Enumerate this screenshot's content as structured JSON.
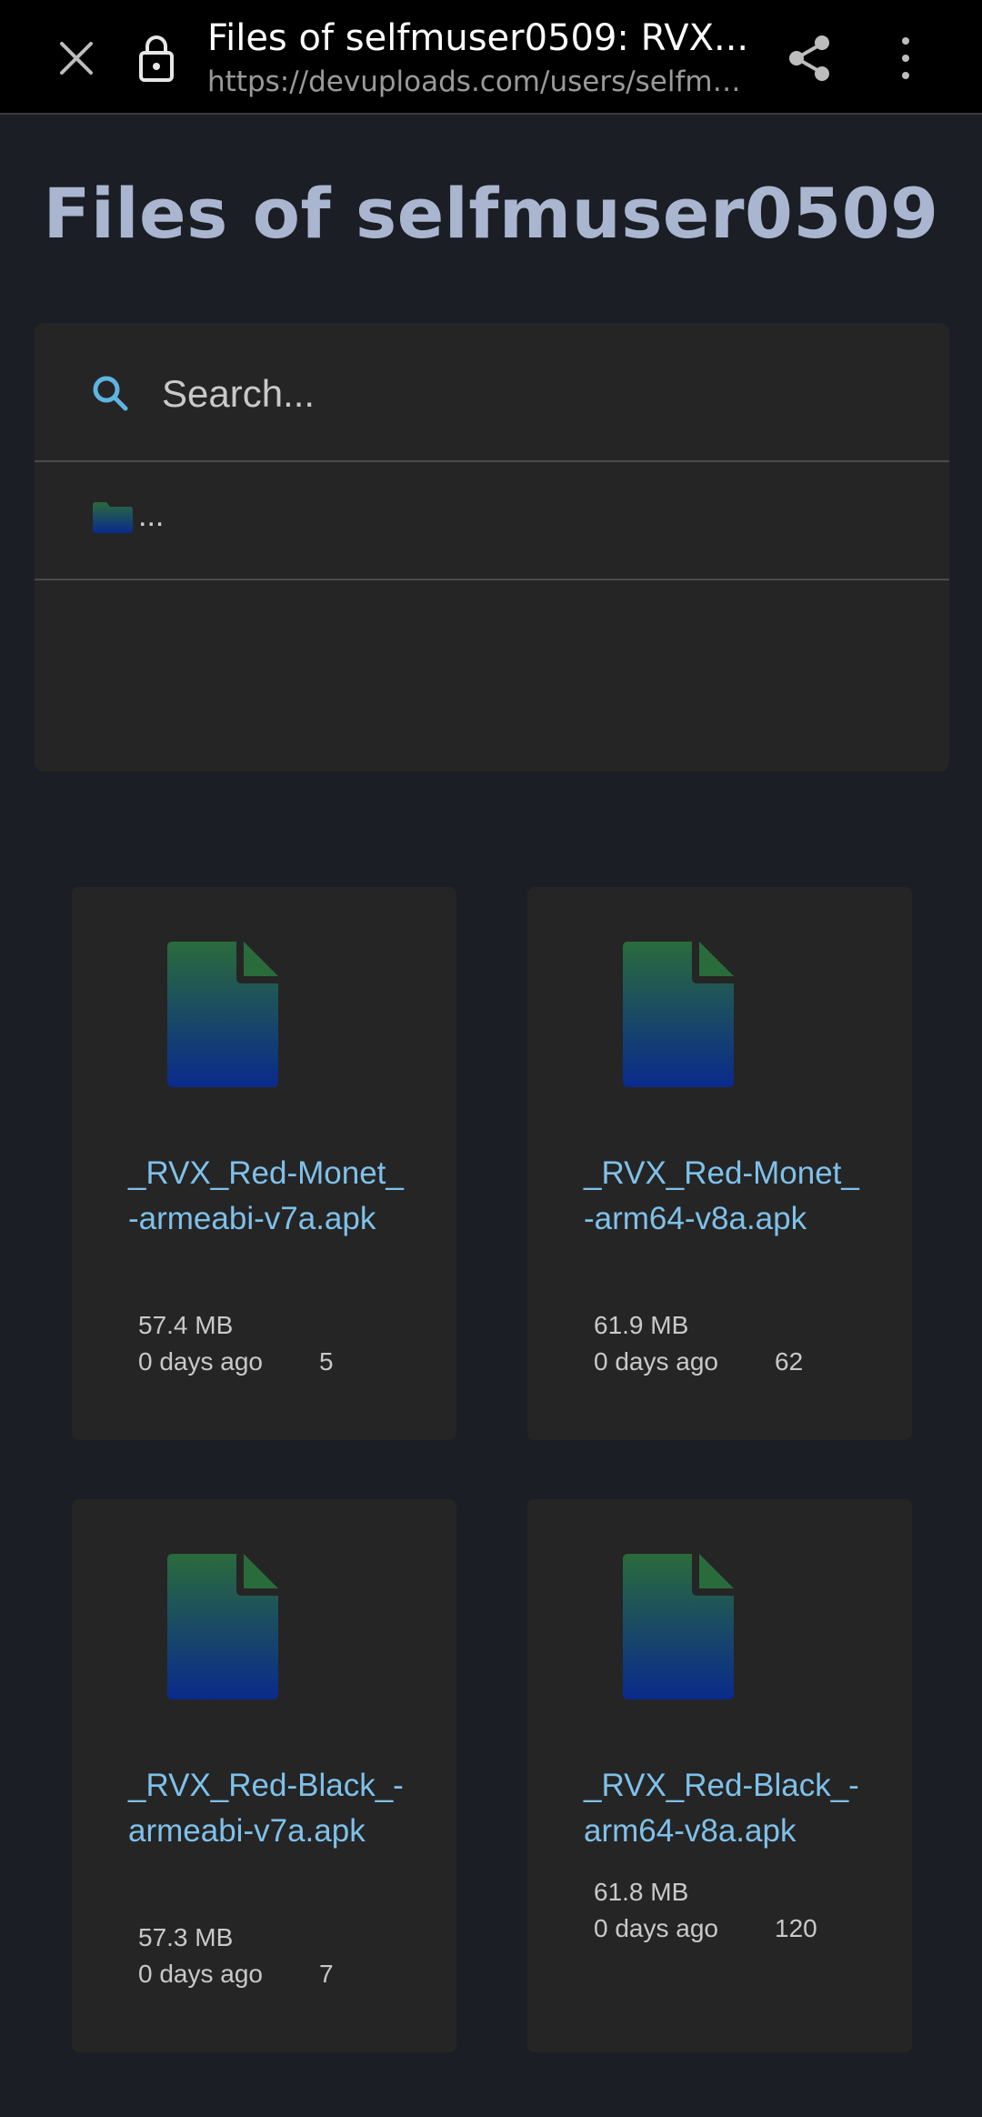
{
  "browser": {
    "page_title": "Files of selfmuser0509: RVX...",
    "url": "https://devuploads.com/users/selfmu..."
  },
  "page": {
    "heading": "Files of selfmuser0509",
    "search_placeholder": "Search...",
    "folder_label": "..."
  },
  "files": [
    {
      "name": "_RVX_Red-Monet_-armeabi-v7a.apk",
      "size": "57.4 MB",
      "age": "0 days ago",
      "count": "5"
    },
    {
      "name": "_RVX_Red-Monet_-arm64-v8a.apk",
      "size": "61.9 MB",
      "age": "0 days ago",
      "count": "62"
    },
    {
      "name": "_RVX_Red-Black_-armeabi-v7a.apk",
      "size": "57.3 MB",
      "age": "0 days ago",
      "count": "7"
    },
    {
      "name": "_RVX_Red-Black_-arm64-v8a.apk",
      "size": "61.8 MB",
      "age": "0 days ago",
      "count": "120"
    }
  ],
  "colors": {
    "background": "#1b1e25",
    "card": "#252525",
    "heading": "#aab6d0",
    "link": "#7fc1ea",
    "icon_top": "#2a6b3c",
    "icon_bottom": "#0a2a8c"
  },
  "icons": [
    "close-icon",
    "lock-icon",
    "share-icon",
    "more-vert-icon",
    "search-icon",
    "folder-icon",
    "file-icon"
  ]
}
